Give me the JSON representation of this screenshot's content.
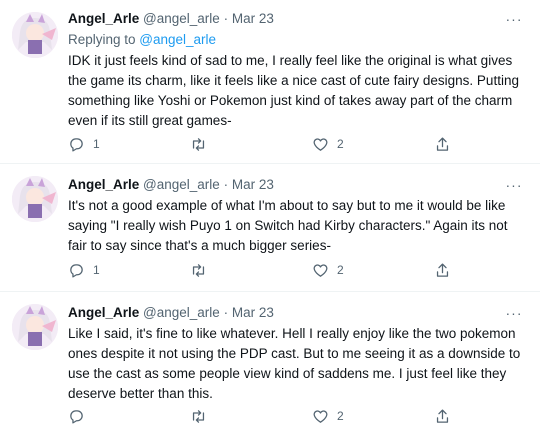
{
  "tweets": [
    {
      "display_name": "Angel_Arle",
      "handle": "@angel_arle",
      "dot": "·",
      "date": "Mar 23",
      "reply_prefix": "Replying to ",
      "reply_to": "@angel_arle",
      "text": "IDK it just feels kind of sad to me, I really feel like the original is what gives the game its charm, like it feels like a nice cast of cute fairy designs. Putting something like Yoshi or Pokemon just kind of takes away part of the charm even if its still great games-",
      "reply_count": "1",
      "retweet_count": "",
      "like_count": "2",
      "more_label": "···"
    },
    {
      "display_name": "Angel_Arle",
      "handle": "@angel_arle",
      "dot": "·",
      "date": "Mar 23",
      "text": "It's not a good example of what I'm about to say but to me it would be like saying \"I really wish Puyo 1 on Switch had Kirby characters.\" Again its not fair to say since that's a much bigger series-",
      "reply_count": "1",
      "retweet_count": "",
      "like_count": "2",
      "more_label": "···"
    },
    {
      "display_name": "Angel_Arle",
      "handle": "@angel_arle",
      "dot": "·",
      "date": "Mar 23",
      "text": "Like I said, it's fine to like whatever. Hell I really enjoy like the two pokemon ones despite it not using the PDP cast. But to me seeing it as a downside to use the cast as some people view kind of saddens me. I just feel like they deserve better than this.",
      "reply_count": "",
      "retweet_count": "",
      "like_count": "2",
      "more_label": "···"
    }
  ],
  "icons": {
    "reply": "reply-icon",
    "retweet": "retweet-icon",
    "like": "heart-icon",
    "share": "share-icon",
    "more": "more-icon"
  },
  "colors": {
    "link": "#1d9bf0",
    "secondary_text": "#536471",
    "divider": "#eff3f4"
  }
}
